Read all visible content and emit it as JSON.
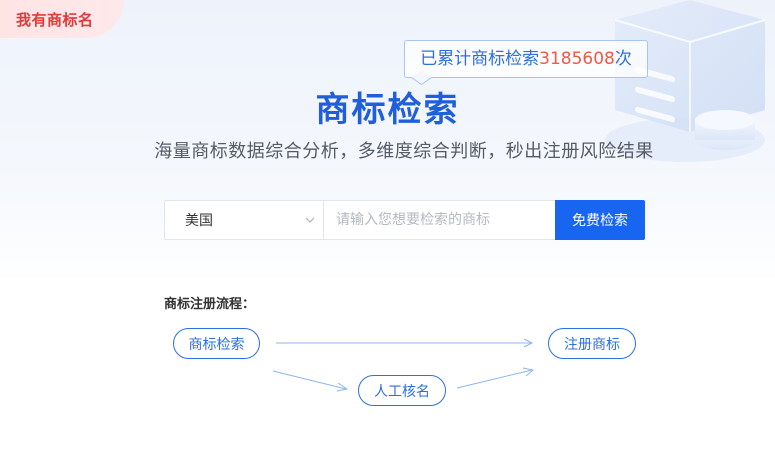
{
  "corner_badge": {
    "label": "我有商标名"
  },
  "counter": {
    "prefix": "已累计商标检索",
    "count": "3185608",
    "suffix": "次"
  },
  "hero": {
    "title": "商标检索",
    "subtitle": "海量商标数据综合分析，多维度综合判断，秒出注册风险结果"
  },
  "search": {
    "country": "美国",
    "placeholder": "请输入您想要检索的商标",
    "value": "",
    "button_label": "免费检索"
  },
  "flow": {
    "title": "商标注册流程：",
    "steps": {
      "search": "商标检索",
      "register": "注册商标",
      "manual": "人工核名"
    }
  },
  "colors": {
    "brand_blue": "#1765f0",
    "title_blue": "#1f5fdc",
    "badge_red": "#e03a3a",
    "count_orange": "#ee5a44"
  }
}
